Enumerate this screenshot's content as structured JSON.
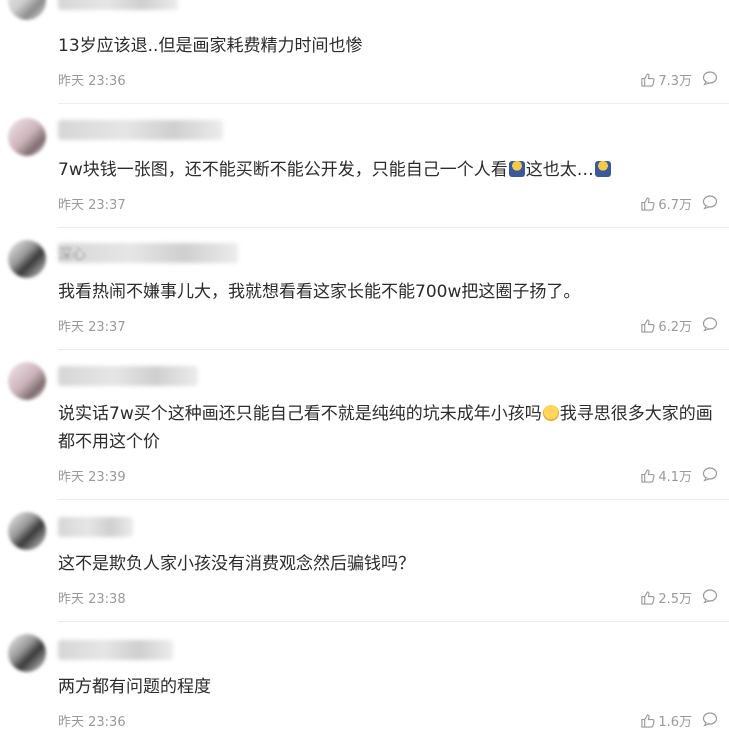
{
  "comments": [
    {
      "text": "13岁应该退..但是画家耗费精力时间也惨",
      "time": "昨天 23:36",
      "likes": "7.3万"
    },
    {
      "text_a": "7w块钱一张图，还不能买断不能公开发，只能自己一个人看",
      "text_b": "这也太…",
      "time": "昨天 23:37",
      "likes": "6.7万"
    },
    {
      "user_fragment": "深心",
      "text": "我看热闹不嫌事儿大，我就想看看这家长能不能700w把这圈子扬了。",
      "time": "昨天 23:37",
      "likes": "6.2万"
    },
    {
      "text_a": "说实话7w买个这种画还只能自己看不就是纯纯的坑未成年小孩吗",
      "text_b": "我寻思很多大家的画都不用这个价",
      "time": "昨天 23:39",
      "likes": "4.1万"
    },
    {
      "text": "这不是欺负人家小孩没有消费观念然后骗钱吗？",
      "time": "昨天 23:38",
      "likes": "2.5万"
    },
    {
      "text": "两方都有问题的程度",
      "time": "昨天 23:36",
      "likes": "1.6万"
    }
  ],
  "icons": {
    "like": "thumb-up-icon",
    "reply": "comment-bubble-icon",
    "emoji_1": "facepalm-emoji-icon",
    "emoji_2": "smiling-face-emoji-icon"
  },
  "colors": {
    "text": "#2b2b2b",
    "meta": "#999999",
    "divider": "#ececec"
  }
}
